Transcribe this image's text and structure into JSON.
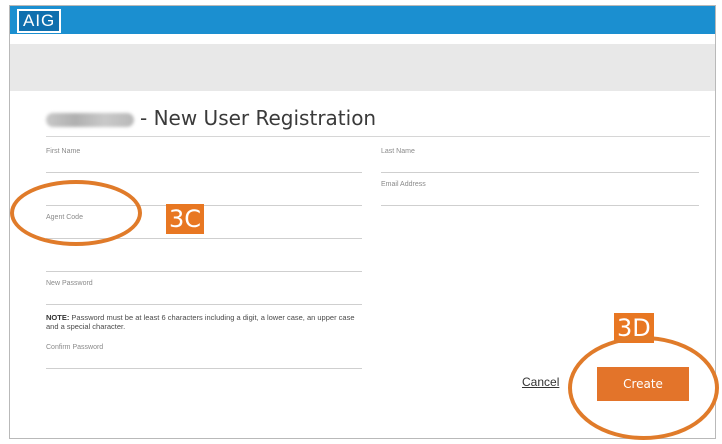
{
  "header": {
    "logo_text": "AIG"
  },
  "form": {
    "title_suffix": "- New User Registration",
    "fields_left": [
      {
        "label": "First Name"
      },
      {
        "label": ""
      },
      {
        "label": "Agent Code"
      },
      {
        "label": ""
      },
      {
        "label": "New Password"
      }
    ],
    "fields_right": [
      {
        "label": "Last Name"
      },
      {
        "label": "Email Address"
      }
    ],
    "note_bold": "NOTE:",
    "note_text": " Password must be at least 6 characters including a digit, a lower case, an upper case and a special character.",
    "confirm_password_label": "Confirm Password"
  },
  "actions": {
    "cancel_label": "Cancel",
    "create_label": "Create"
  },
  "annotations": {
    "callout_agent_code": "3C",
    "callout_create": "3D"
  },
  "colors": {
    "accent": "#e3742a",
    "topbar": "#1b8fd0",
    "subbar": "#e8e8e8"
  }
}
